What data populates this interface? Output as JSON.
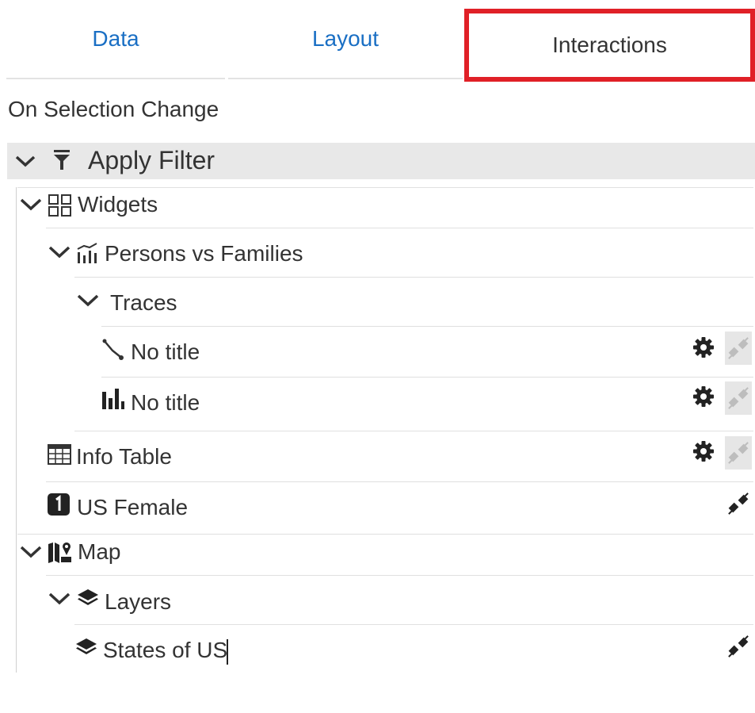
{
  "tabs": {
    "data": "Data",
    "layout": "Layout",
    "interactions": "Interactions"
  },
  "section_title": "On Selection Change",
  "apply_filter": "Apply Filter",
  "tree": {
    "widgets": "Widgets",
    "persons_vs_families": "Persons vs Families",
    "traces": "Traces",
    "trace_line": "No title",
    "trace_bar": "No title",
    "info_table": "Info Table",
    "us_female": "US Female",
    "map": "Map",
    "layers": "Layers",
    "states_of_us": "States of US"
  },
  "colors": {
    "tab_link": "#1a6fc4",
    "highlight": "#e02027",
    "header_bg": "#e8e8e8"
  }
}
